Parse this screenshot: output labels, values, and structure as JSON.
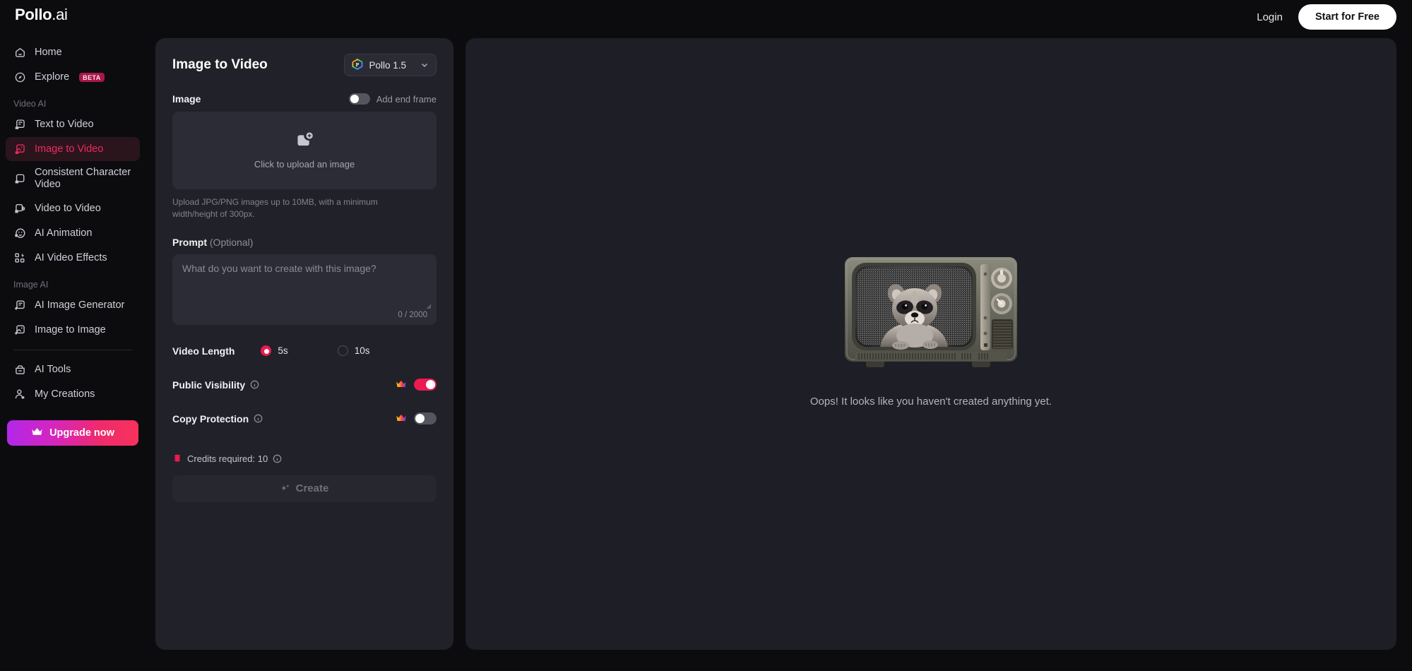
{
  "brand": {
    "name": "Pollo",
    "suffix": ".ai"
  },
  "topbar": {
    "login_label": "Login",
    "start_free_label": "Start for Free"
  },
  "sidebar": {
    "items": [
      {
        "label": "Home",
        "icon": "home-icon",
        "badge": ""
      },
      {
        "label": "Explore",
        "icon": "compass-icon",
        "badge": "BETA"
      }
    ],
    "groups": [
      {
        "label": "Video AI",
        "items": [
          {
            "label": "Text to Video",
            "icon": "text-to-video-icon",
            "active": false
          },
          {
            "label": "Image to Video",
            "icon": "image-to-video-icon",
            "active": true
          },
          {
            "label": "Consistent Character Video",
            "icon": "character-video-icon",
            "active": false
          },
          {
            "label": "Video to Video",
            "icon": "video-to-video-icon",
            "active": false
          },
          {
            "label": "AI Animation",
            "icon": "ai-animation-icon",
            "active": false
          },
          {
            "label": "AI Video Effects",
            "icon": "ai-video-effects-icon",
            "active": false
          }
        ]
      },
      {
        "label": "Image AI",
        "items": [
          {
            "label": "AI Image Generator",
            "icon": "ai-image-generator-icon",
            "active": false
          },
          {
            "label": "Image to Image",
            "icon": "image-to-image-icon",
            "active": false
          }
        ]
      }
    ],
    "tools": [
      {
        "label": "AI Tools",
        "icon": "tools-icon"
      },
      {
        "label": "My Creations",
        "icon": "user-icon"
      }
    ],
    "upgrade_label": "Upgrade now"
  },
  "panel": {
    "title": "Image to Video",
    "model": {
      "name": "Pollo 1.5",
      "icon": "pollo-logo-icon"
    },
    "image_section": {
      "label": "Image",
      "end_frame_label": "Add end frame",
      "end_frame_on": false,
      "dropzone_text": "Click to upload an image",
      "upload_hint": "Upload JPG/PNG images up to 10MB, with a minimum width/height of 300px."
    },
    "prompt_section": {
      "label": "Prompt",
      "optional_suffix": "(Optional)",
      "placeholder": "What do you want to create with this image?",
      "value": "",
      "char_count": "0 / 2000"
    },
    "video_length": {
      "label": "Video Length",
      "options": [
        {
          "label": "5s",
          "selected": true
        },
        {
          "label": "10s",
          "selected": false
        }
      ]
    },
    "public_visibility": {
      "label": "Public Visibility",
      "on": true,
      "premium": true
    },
    "copy_protection": {
      "label": "Copy Protection",
      "on": false,
      "premium": true
    },
    "credits_label": "Credits required: 10",
    "create_label": "Create"
  },
  "canvas": {
    "empty_message": "Oops! It looks like you haven't created anything yet.",
    "illustration": "retro-tv-raccoon-image"
  },
  "colors": {
    "accent": "#ec1a52",
    "page_bg": "#0c0c0f",
    "panel_bg": "#212129",
    "canvas_bg": "#1e1e26",
    "upgrade_gradient_start": "#b227e8",
    "upgrade_gradient_end": "#f8325a"
  }
}
